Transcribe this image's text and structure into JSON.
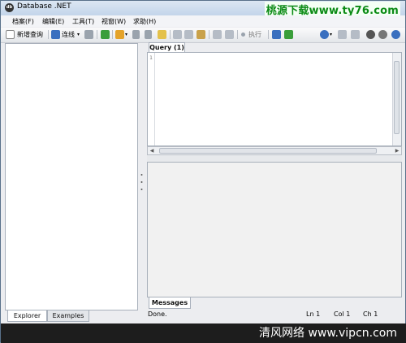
{
  "window": {
    "title": "Database .NET"
  },
  "watermark_top": "桃源下载www.ty76.com",
  "watermark_bottom": "清风网络 www.vipcn.com",
  "menu": [
    {
      "label": "档案(F)"
    },
    {
      "label": "编辑(E)"
    },
    {
      "label": "工具(T)"
    },
    {
      "label": "视窗(W)"
    },
    {
      "label": "求助(H)"
    }
  ],
  "toolbar": {
    "new_query": "新增查询",
    "connect": "连线",
    "execute": "执行",
    "icon_colors": {
      "green": "#3a9e3a",
      "orange": "#e4a32a",
      "blue": "#3a6fbf",
      "gray": "#9aa3ad"
    }
  },
  "editor": {
    "tab": "Query (1)",
    "line_number": "1"
  },
  "results": {
    "tab": "Messages"
  },
  "left_tabs": [
    {
      "label": "Explorer"
    },
    {
      "label": "Examples"
    }
  ],
  "status": {
    "text": "Done.",
    "line": "Ln 1",
    "col": "Col 1",
    "ch": "Ch 1"
  }
}
